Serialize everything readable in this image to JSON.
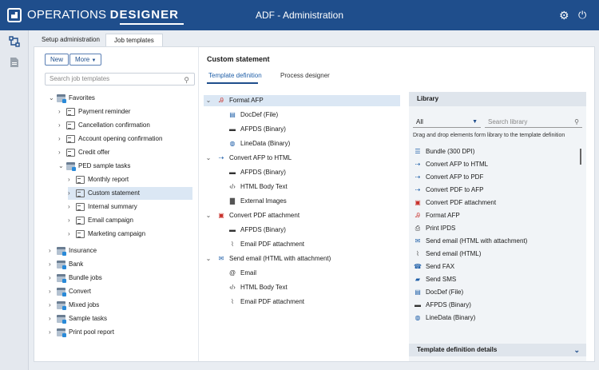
{
  "header": {
    "brand_light": "OPERATIONS",
    "brand_bold": "DESIGNER",
    "title": "ADF - Administration",
    "icons": [
      "gear-icon",
      "power-icon"
    ]
  },
  "tabs": [
    {
      "label": "Setup administration",
      "active": false
    },
    {
      "label": "Job templates",
      "active": true
    }
  ],
  "toolbar": {
    "new_label": "New",
    "more_label": "More"
  },
  "search": {
    "placeholder": "Search job templates"
  },
  "tree": [
    {
      "label": "Favorites",
      "expanded": true,
      "type": "folder"
    },
    {
      "label": "Payment reminder",
      "type": "doc"
    },
    {
      "label": "Cancellation confirmation",
      "type": "doc"
    },
    {
      "label": "Account opening confirmation",
      "type": "doc"
    },
    {
      "label": "Credit offer",
      "type": "doc"
    },
    {
      "label": "PED sample tasks",
      "expanded": true,
      "type": "folder"
    },
    {
      "label": "Monthly report",
      "type": "doc"
    },
    {
      "label": "Custom statement",
      "type": "doc",
      "selected": true
    },
    {
      "label": "Internal summary",
      "type": "doc"
    },
    {
      "label": "Email campaign",
      "type": "doc"
    },
    {
      "label": "Marketing campaign",
      "type": "doc"
    },
    {
      "label": "Insurance",
      "type": "folder"
    },
    {
      "label": "Bank",
      "type": "folder"
    },
    {
      "label": "Bundle jobs",
      "type": "folder"
    },
    {
      "label": "Convert",
      "type": "folder"
    },
    {
      "label": "Mixed jobs",
      "type": "folder"
    },
    {
      "label": "Sample tasks",
      "type": "folder"
    },
    {
      "label": "Print pool report",
      "type": "folder"
    }
  ],
  "center": {
    "title": "Custom statement",
    "tabs": [
      "Template definition",
      "Process designer"
    ],
    "nodes": [
      {
        "label": "Format AFP",
        "level": 0,
        "icon": "format-afp-icon"
      },
      {
        "label": "DocDef (File)",
        "level": 1,
        "icon": "docdef-icon"
      },
      {
        "label": "AFPDS (Binary)",
        "level": 1,
        "icon": "afp-badge-icon"
      },
      {
        "label": "LineData (Binary)",
        "level": 1,
        "icon": "linedata-icon"
      },
      {
        "label": "Convert AFP to HTML",
        "level": 0,
        "icon": "convert-html-icon"
      },
      {
        "label": "AFPDS (Binary)",
        "level": 1,
        "icon": "afp-badge-icon"
      },
      {
        "label": "HTML Body Text",
        "level": 1,
        "icon": "code-icon"
      },
      {
        "label": "External Images",
        "level": 1,
        "icon": "folder-icon"
      },
      {
        "label": "Convert PDF attachment",
        "level": 0,
        "icon": "pdf-icon"
      },
      {
        "label": "AFPDS (Binary)",
        "level": 1,
        "icon": "afp-badge-icon"
      },
      {
        "label": "Email PDF attachment",
        "level": 1,
        "icon": "paperclip-icon"
      },
      {
        "label": "Send email (HTML with attachment)",
        "level": 0,
        "icon": "send-email-icon"
      },
      {
        "label": "Email",
        "level": 1,
        "icon": "at-icon"
      },
      {
        "label": "HTML Body Text",
        "level": 1,
        "icon": "code-icon"
      },
      {
        "label": "Email PDF attachment",
        "level": 1,
        "icon": "paperclip-icon"
      }
    ]
  },
  "library": {
    "title": "Library",
    "filter_value": "All",
    "search_placeholder": "Search library",
    "hint": "Drag and drop elements form library to the template definition",
    "items": [
      {
        "label": "Bundle (300 DPI)",
        "icon": "bundle-icon"
      },
      {
        "label": "Convert AFP to HTML",
        "icon": "convert-html-icon"
      },
      {
        "label": "Convert AFP to PDF",
        "icon": "convert-pdf-icon"
      },
      {
        "label": "Convert PDF to AFP",
        "icon": "convert-afp-icon"
      },
      {
        "label": "Convert PDF attachment",
        "icon": "pdf-icon"
      },
      {
        "label": "Format AFP",
        "icon": "format-afp-icon"
      },
      {
        "label": "Print IPDS",
        "icon": "print-ipds-icon"
      },
      {
        "label": "Send email (HTML with attachment)",
        "icon": "send-email-icon"
      },
      {
        "label": "Send email (HTML)",
        "icon": "paperclip-icon"
      },
      {
        "label": "Send FAX",
        "icon": "fax-icon"
      },
      {
        "label": "Send SMS",
        "icon": "sms-icon"
      },
      {
        "label": "DocDef (File)",
        "icon": "docdef-icon"
      },
      {
        "label": "AFPDS (Binary)",
        "icon": "afp-badge-icon"
      },
      {
        "label": "LineData (Binary)",
        "icon": "linedata-icon"
      }
    ],
    "details_label": "Template definition details"
  }
}
